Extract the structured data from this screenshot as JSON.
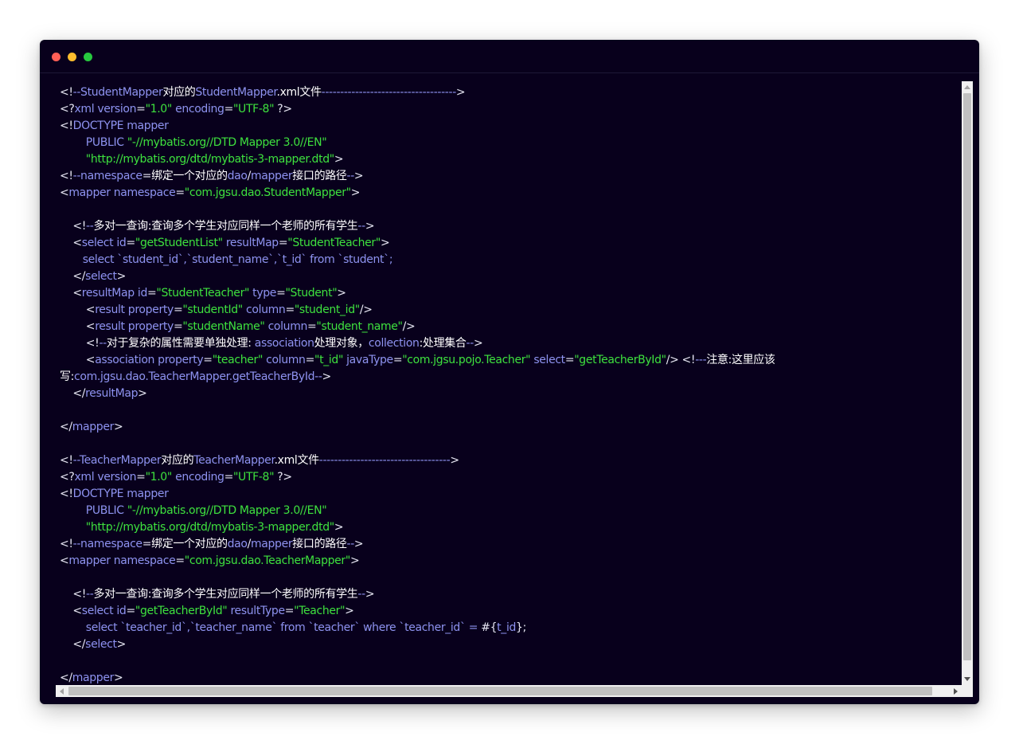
{
  "window": {
    "controls": [
      {
        "name": "close",
        "color": "#ff5f56"
      },
      {
        "name": "minimize",
        "color": "#ffbd2e"
      },
      {
        "name": "maximize",
        "color": "#27c93f"
      }
    ]
  },
  "theme": {
    "background": "#08001c",
    "punctuation": "#e8e8f4",
    "name": "#8e93f0",
    "string": "#3ee23e",
    "comment_text": "#ffffff"
  },
  "code_lines": [
    [
      [
        "p",
        "<!"
      ],
      [
        "c",
        "--StudentMapper"
      ],
      [
        "w",
        "对应的"
      ],
      [
        "c",
        "StudentMapper"
      ],
      [
        "w",
        ".xml文件"
      ],
      [
        "c",
        "------------------------------------"
      ],
      [
        "p",
        ">"
      ]
    ],
    [
      [
        "p",
        "<?"
      ],
      [
        "n",
        "xml version"
      ],
      [
        "p",
        "="
      ],
      [
        "s",
        "\"1.0\""
      ],
      [
        "n",
        " encoding"
      ],
      [
        "p",
        "="
      ],
      [
        "s",
        "\"UTF-8\""
      ],
      [
        "p",
        " ?>"
      ]
    ],
    [
      [
        "p",
        "<!"
      ],
      [
        "n",
        "DOCTYPE mapper"
      ]
    ],
    [
      [
        "n",
        "        PUBLIC "
      ],
      [
        "s",
        "\"-//mybatis.org//DTD Mapper 3.0//EN\""
      ]
    ],
    [
      [
        "s",
        "        \"http://mybatis.org/dtd/mybatis-3-mapper.dtd\""
      ],
      [
        "p",
        ">"
      ]
    ],
    [
      [
        "p",
        "<!"
      ],
      [
        "c",
        "--namespace"
      ],
      [
        "p",
        "="
      ],
      [
        "w",
        "绑定一个对应的"
      ],
      [
        "c",
        "dao"
      ],
      [
        "p",
        "/"
      ],
      [
        "c",
        "mapper"
      ],
      [
        "w",
        "接口的路径"
      ],
      [
        "c",
        "--"
      ],
      [
        "p",
        ">"
      ]
    ],
    [
      [
        "p",
        "<"
      ],
      [
        "n",
        "mapper namespace"
      ],
      [
        "p",
        "="
      ],
      [
        "s",
        "\"com.jgsu.dao.StudentMapper\""
      ],
      [
        "p",
        ">"
      ]
    ],
    [],
    [
      [
        "p",
        "    <!"
      ],
      [
        "c",
        "--"
      ],
      [
        "w",
        "多对一查询:查询多个学生对应同样一个老师的所有学生"
      ],
      [
        "c",
        "--"
      ],
      [
        "p",
        ">"
      ]
    ],
    [
      [
        "p",
        "    <"
      ],
      [
        "n",
        "select id"
      ],
      [
        "p",
        "="
      ],
      [
        "s",
        "\"getStudentList\""
      ],
      [
        "n",
        " resultMap"
      ],
      [
        "p",
        "="
      ],
      [
        "s",
        "\"StudentTeacher\""
      ],
      [
        "p",
        ">"
      ]
    ],
    [
      [
        "n",
        "       select `student_id`,`student_name`,`t_id` from `student`;"
      ]
    ],
    [
      [
        "p",
        "    </"
      ],
      [
        "n",
        "select"
      ],
      [
        "p",
        ">"
      ]
    ],
    [
      [
        "p",
        "    <"
      ],
      [
        "n",
        "resultMap id"
      ],
      [
        "p",
        "="
      ],
      [
        "s",
        "\"StudentTeacher\""
      ],
      [
        "n",
        " type"
      ],
      [
        "p",
        "="
      ],
      [
        "s",
        "\"Student\""
      ],
      [
        "p",
        ">"
      ]
    ],
    [
      [
        "p",
        "        <"
      ],
      [
        "n",
        "result property"
      ],
      [
        "p",
        "="
      ],
      [
        "s",
        "\"studentId\""
      ],
      [
        "n",
        " column"
      ],
      [
        "p",
        "="
      ],
      [
        "s",
        "\"student_id\""
      ],
      [
        "p",
        "/>"
      ]
    ],
    [
      [
        "p",
        "        <"
      ],
      [
        "n",
        "result property"
      ],
      [
        "p",
        "="
      ],
      [
        "s",
        "\"studentName\""
      ],
      [
        "n",
        " column"
      ],
      [
        "p",
        "="
      ],
      [
        "s",
        "\"student_name\""
      ],
      [
        "p",
        "/>"
      ]
    ],
    [
      [
        "p",
        "        <!"
      ],
      [
        "c",
        "--"
      ],
      [
        "w",
        "对于复杂的属性需要单独处理: "
      ],
      [
        "c",
        "association"
      ],
      [
        "w",
        "处理对象，"
      ],
      [
        "c",
        "collection"
      ],
      [
        "w",
        ":处理集合"
      ],
      [
        "c",
        "--"
      ],
      [
        "p",
        ">"
      ]
    ],
    [
      [
        "p",
        "        <"
      ],
      [
        "n",
        "association property"
      ],
      [
        "p",
        "="
      ],
      [
        "s",
        "\"teacher\""
      ],
      [
        "n",
        " column"
      ],
      [
        "p",
        "="
      ],
      [
        "s",
        "\"t_id\""
      ],
      [
        "n",
        " javaType"
      ],
      [
        "p",
        "="
      ],
      [
        "s",
        "\"com.jgsu.pojo.Teacher\""
      ],
      [
        "n",
        " select"
      ],
      [
        "p",
        "="
      ],
      [
        "s",
        "\"getTeacherById\""
      ],
      [
        "p",
        "/> <!"
      ],
      [
        "c",
        "---"
      ],
      [
        "w",
        "注意:这里应该"
      ]
    ],
    [
      [
        "w",
        "写:"
      ],
      [
        "c",
        "com.jgsu.dao.TeacherMapper.getTeacherById--"
      ],
      [
        "p",
        ">"
      ]
    ],
    [
      [
        "p",
        "    </"
      ],
      [
        "n",
        "resultMap"
      ],
      [
        "p",
        ">"
      ]
    ],
    [],
    [
      [
        "p",
        "</"
      ],
      [
        "n",
        "mapper"
      ],
      [
        "p",
        ">"
      ]
    ],
    [],
    [
      [
        "p",
        "<!"
      ],
      [
        "c",
        "--TeacherMapper"
      ],
      [
        "w",
        "对应的"
      ],
      [
        "c",
        "TeacherMapper"
      ],
      [
        "w",
        ".xml文件"
      ],
      [
        "c",
        "-----------------------------------"
      ],
      [
        "p",
        ">"
      ]
    ],
    [
      [
        "p",
        "<?"
      ],
      [
        "n",
        "xml version"
      ],
      [
        "p",
        "="
      ],
      [
        "s",
        "\"1.0\""
      ],
      [
        "n",
        " encoding"
      ],
      [
        "p",
        "="
      ],
      [
        "s",
        "\"UTF-8\""
      ],
      [
        "p",
        " ?>"
      ]
    ],
    [
      [
        "p",
        "<!"
      ],
      [
        "n",
        "DOCTYPE mapper"
      ]
    ],
    [
      [
        "n",
        "        PUBLIC "
      ],
      [
        "s",
        "\"-//mybatis.org//DTD Mapper 3.0//EN\""
      ]
    ],
    [
      [
        "s",
        "        \"http://mybatis.org/dtd/mybatis-3-mapper.dtd\""
      ],
      [
        "p",
        ">"
      ]
    ],
    [
      [
        "p",
        "<!"
      ],
      [
        "c",
        "--namespace"
      ],
      [
        "p",
        "="
      ],
      [
        "w",
        "绑定一个对应的"
      ],
      [
        "c",
        "dao"
      ],
      [
        "p",
        "/"
      ],
      [
        "c",
        "mapper"
      ],
      [
        "w",
        "接口的路径"
      ],
      [
        "c",
        "--"
      ],
      [
        "p",
        ">"
      ]
    ],
    [
      [
        "p",
        "<"
      ],
      [
        "n",
        "mapper namespace"
      ],
      [
        "p",
        "="
      ],
      [
        "s",
        "\"com.jgsu.dao.TeacherMapper\""
      ],
      [
        "p",
        ">"
      ]
    ],
    [],
    [
      [
        "p",
        "    <!"
      ],
      [
        "c",
        "--"
      ],
      [
        "w",
        "多对一查询:查询多个学生对应同样一个老师的所有学生"
      ],
      [
        "c",
        "--"
      ],
      [
        "p",
        ">"
      ]
    ],
    [
      [
        "p",
        "    <"
      ],
      [
        "n",
        "select id"
      ],
      [
        "p",
        "="
      ],
      [
        "s",
        "\"getTeacherById\""
      ],
      [
        "n",
        " resultType"
      ],
      [
        "p",
        "="
      ],
      [
        "s",
        "\"Teacher\""
      ],
      [
        "p",
        ">"
      ]
    ],
    [
      [
        "n",
        "        select `teacher_id`,`teacher_name` from `teacher` where `teacher_id` = "
      ],
      [
        "p",
        "#{"
      ],
      [
        "n",
        "t_id"
      ],
      [
        "p",
        "};"
      ]
    ],
    [
      [
        "p",
        "    </"
      ],
      [
        "n",
        "select"
      ],
      [
        "p",
        ">"
      ]
    ],
    [],
    [
      [
        "p",
        "</"
      ],
      [
        "n",
        "mapper"
      ],
      [
        "p",
        ">"
      ]
    ]
  ]
}
